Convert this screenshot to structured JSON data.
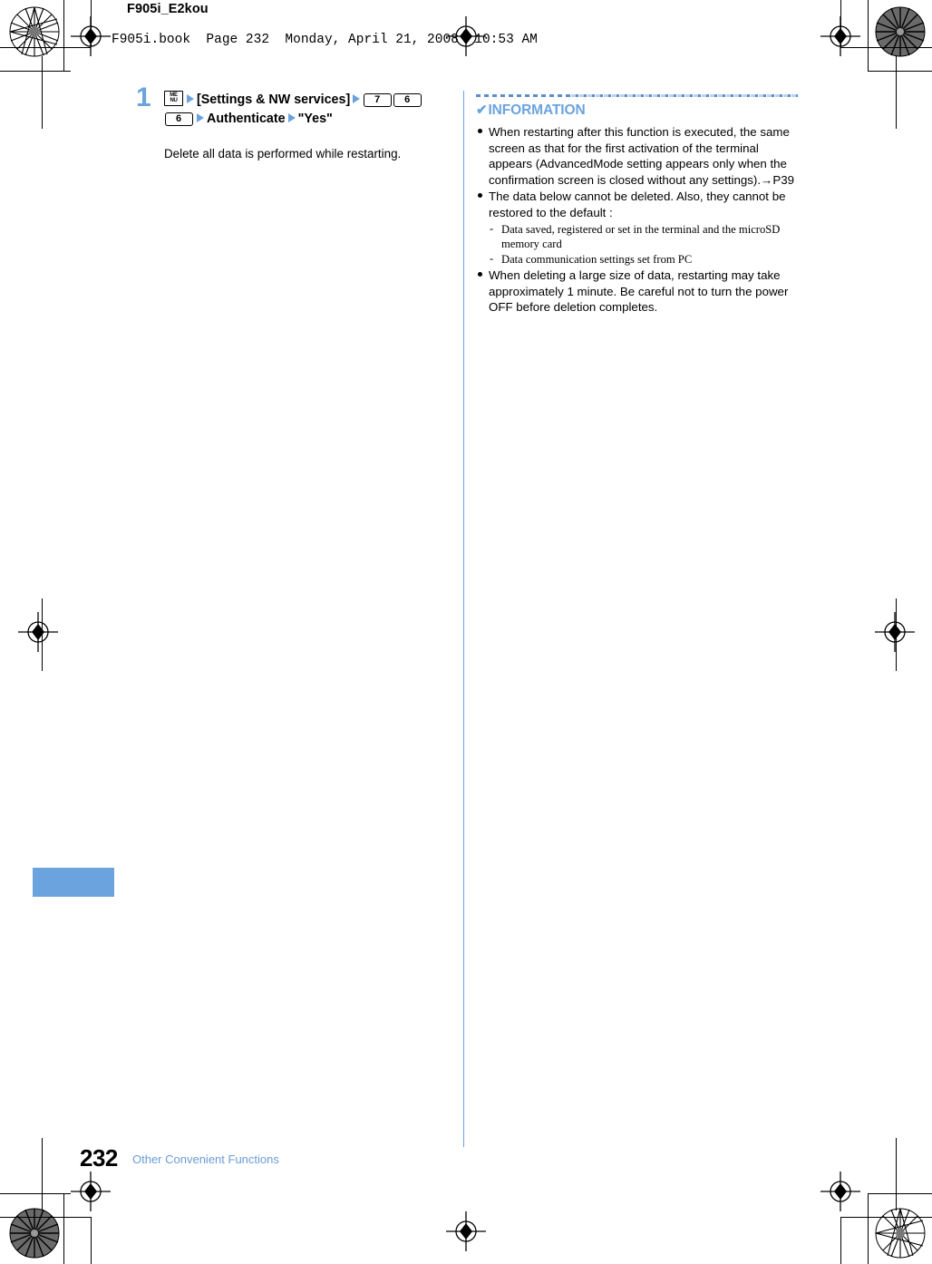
{
  "header": {
    "doc_id": "F905i_E2kou",
    "book_line": "F905i.book  Page 232  Monday, April 21, 2008  10:53 AM"
  },
  "step": {
    "number": "1",
    "menu_key_top": "ME",
    "menu_key_bottom": "NU",
    "bracket_label": "[Settings & NW services]",
    "keys": [
      "7",
      "6",
      "6"
    ],
    "authenticate_label": "Authenticate",
    "yes_label": "\"Yes\"",
    "note": "Delete all data is performed while restarting."
  },
  "information": {
    "check_glyph": "✔",
    "title": "INFORMATION",
    "items": [
      {
        "text": "When restarting after this function is executed, the same screen as that for the first activation of the terminal appears (AdvancedMode setting appears only when the confirmation screen is closed without any settings).→P39"
      },
      {
        "text": "The data below cannot be deleted. Also, they cannot be restored to the default :",
        "sub_items": [
          "Data saved, registered or set in the terminal and the microSD memory card",
          "Data communication settings set from PC"
        ]
      },
      {
        "text": "When deleting a large size of data, restarting may take approximately 1 minute. Be careful not to turn the power OFF before deletion completes."
      }
    ]
  },
  "footer": {
    "page_number": "232",
    "chapter_name": "Other Convenient Functions"
  },
  "colors": {
    "accent_blue": "#6ba3de",
    "footer_blue": "#6b9bd8",
    "dots_dark": "#5b8fc9",
    "dots_light": "#bcd3ea"
  }
}
